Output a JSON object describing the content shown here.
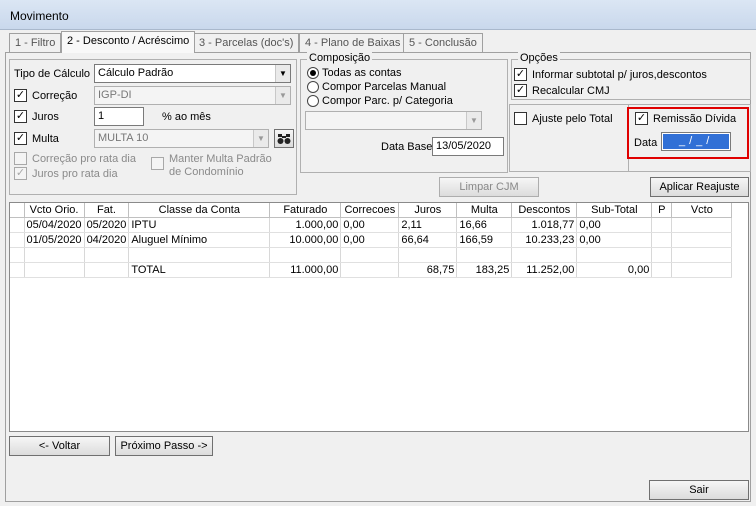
{
  "window": {
    "title": "Movimento"
  },
  "tabs": [
    {
      "label": "1 - Filtro"
    },
    {
      "label": "2 - Desconto / Acréscimo"
    },
    {
      "label": "3 - Parcelas (doc's)"
    },
    {
      "label": "4 - Plano de Baixas"
    },
    {
      "label": "5 - Conclusão"
    }
  ],
  "calculo": {
    "tipo_label": "Tipo de Cálculo",
    "tipo_value": "Cálculo Padrão",
    "correcao_label": "Correção",
    "correcao_value": "IGP-DI",
    "juros_label": "Juros",
    "juros_value": "1",
    "juros_unit": "% ao mês",
    "multa_label": "Multa",
    "multa_value": "MULTA 10",
    "correcao_rata_label": "Correção pro rata dia",
    "juros_rata_label": "Juros pro rata dia",
    "manter_multa_label": "Manter Multa Padrão de Condomínio"
  },
  "composicao": {
    "title": "Composição",
    "options": [
      "Todas as contas",
      "Compor Parcelas Manual",
      "Compor Parc. p/ Categoria"
    ],
    "selected": 0,
    "data_base_label": "Data Base",
    "data_base_value": "13/05/2020"
  },
  "opcoes": {
    "title": "Opções",
    "informar_subtotal_label": "Informar subtotal p/ juros,descontos",
    "recalcular_label": "Recalcular CMJ",
    "ajuste_label": "Ajuste pelo Total",
    "remissao_label": "Remissão Dívida",
    "data_label": "Data",
    "data_value": "_/_/"
  },
  "buttons": {
    "limpar": "Limpar CJM",
    "aplicar": "Aplicar Reajuste",
    "voltar": "<- Voltar",
    "proximo": "Próximo Passo ->",
    "sair": "Sair"
  },
  "grid": {
    "columns": [
      "Vcto Orio.",
      "Fat.",
      "Classe da Conta",
      "Faturado",
      "Correcoes",
      "Juros",
      "Multa",
      "Descontos",
      "Sub-Total",
      "P",
      "Vcto"
    ],
    "rows": [
      [
        "05/04/2020",
        "05/2020",
        "IPTU",
        "1.000,00",
        "0,00",
        "2,11",
        "16,66",
        "1.018,77",
        "0,00",
        "",
        ""
      ],
      [
        "01/05/2020",
        "04/2020",
        "Aluguel Mínimo",
        "10.000,00",
        "0,00",
        "66,64",
        "166,59",
        "10.233,23",
        "0,00",
        "",
        ""
      ]
    ],
    "total": {
      "label": "TOTAL",
      "faturado": "11.000,00",
      "juros": "68,75",
      "multa": "183,25",
      "descontos": "11.252,00",
      "subtotal": "0,00"
    }
  }
}
